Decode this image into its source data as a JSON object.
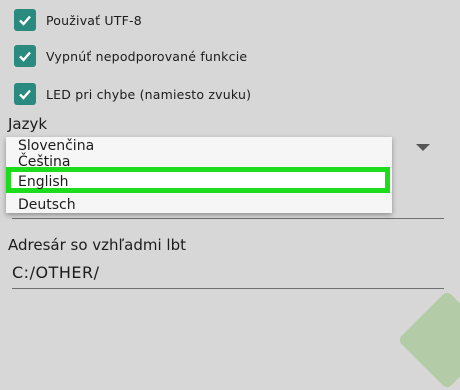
{
  "settings": {
    "checkboxes": [
      {
        "label": "Použivať UTF-8",
        "checked": true
      },
      {
        "label": "Vypnúť nepodporované funkcie",
        "checked": true
      },
      {
        "label": "LED pri chybe (namiesto zvuku)",
        "checked": true
      }
    ],
    "language_label": "Jazyk",
    "language_options": [
      "Slovenčina",
      "Čeština",
      "English",
      "Deutsch"
    ],
    "language_selected": "English",
    "path_label": "Adresár so vzhľadmi lbt",
    "path_value": "C:/OTHER/"
  },
  "colors": {
    "checkbox": "#2a8a80",
    "highlight": "#1cdc1c",
    "background": "#d7d7d7"
  },
  "icons": {
    "check": "check-icon",
    "dropdown": "caret-down-icon"
  }
}
